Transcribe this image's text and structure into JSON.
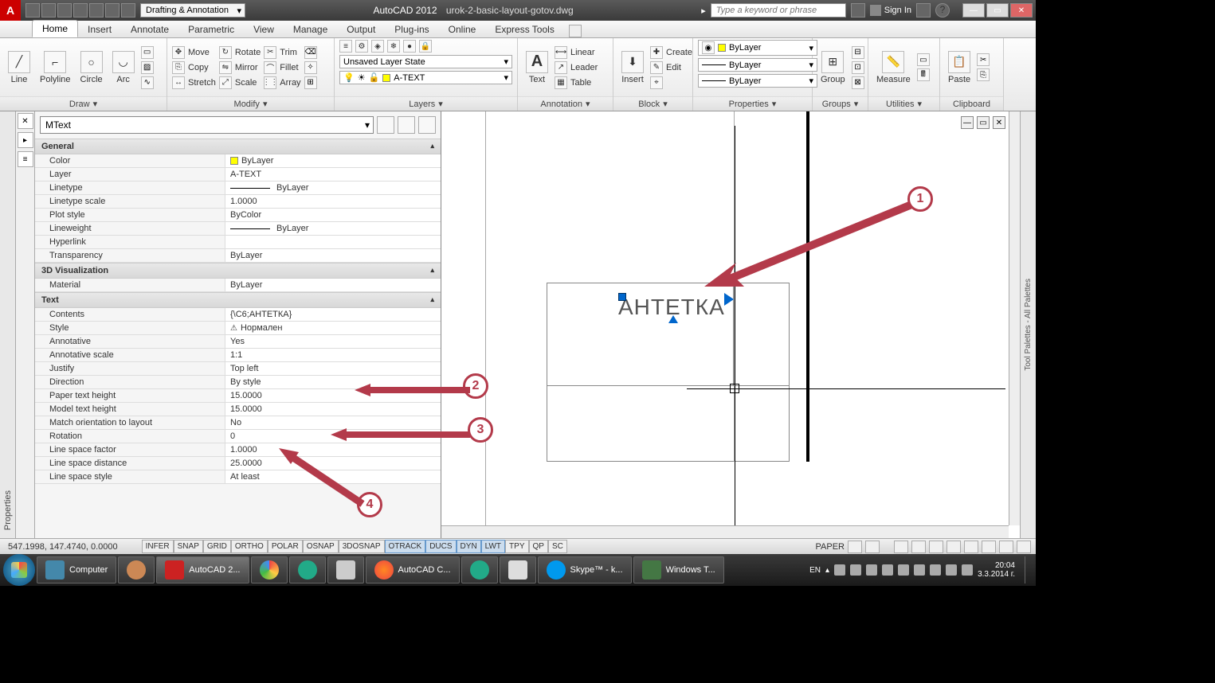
{
  "titlebar": {
    "workspace": "Drafting & Annotation",
    "app": "AutoCAD 2012",
    "file": "urok-2-basic-layout-gotov.dwg",
    "search_placeholder": "Type a keyword or phrase",
    "signin": "Sign In"
  },
  "ribbon_tabs": [
    "Home",
    "Insert",
    "Annotate",
    "Parametric",
    "View",
    "Manage",
    "Output",
    "Plug-ins",
    "Online",
    "Express Tools"
  ],
  "ribbon": {
    "draw": {
      "title": "Draw",
      "line": "Line",
      "polyline": "Polyline",
      "circle": "Circle",
      "arc": "Arc"
    },
    "modify": {
      "title": "Modify",
      "move": "Move",
      "rotate": "Rotate",
      "trim": "Trim",
      "copy": "Copy",
      "mirror": "Mirror",
      "fillet": "Fillet",
      "stretch": "Stretch",
      "scale": "Scale",
      "array": "Array"
    },
    "layers": {
      "title": "Layers",
      "state": "Unsaved Layer State",
      "current": "A-TEXT"
    },
    "annotation": {
      "title": "Annotation",
      "text": "Text",
      "linear": "Linear",
      "leader": "Leader",
      "table": "Table"
    },
    "block": {
      "title": "Block",
      "insert": "Insert",
      "create": "Create",
      "edit": "Edit"
    },
    "properties": {
      "title": "Properties",
      "bylayer": "ByLayer"
    },
    "groups": {
      "title": "Groups",
      "group": "Group"
    },
    "utilities": {
      "title": "Utilities",
      "measure": "Measure"
    },
    "clipboard": {
      "title": "Clipboard",
      "paste": "Paste"
    }
  },
  "properties_palette": {
    "object_type": "MText",
    "sections": {
      "general": {
        "title": "General",
        "rows": [
          {
            "k": "Color",
            "v": "ByLayer",
            "swatch": true
          },
          {
            "k": "Layer",
            "v": "A-TEXT"
          },
          {
            "k": "Linetype",
            "v": "ByLayer",
            "line": true
          },
          {
            "k": "Linetype scale",
            "v": "1.0000"
          },
          {
            "k": "Plot style",
            "v": "ByColor"
          },
          {
            "k": "Lineweight",
            "v": "ByLayer",
            "line": true
          },
          {
            "k": "Hyperlink",
            "v": ""
          },
          {
            "k": "Transparency",
            "v": "ByLayer"
          }
        ]
      },
      "viz3d": {
        "title": "3D Visualization",
        "rows": [
          {
            "k": "Material",
            "v": "ByLayer"
          }
        ]
      },
      "text": {
        "title": "Text",
        "rows": [
          {
            "k": "Contents",
            "v": "{\\C6;АНТЕТКА}"
          },
          {
            "k": "Style",
            "v": "Нормален",
            "anno_icon": true
          },
          {
            "k": "Annotative",
            "v": "Yes"
          },
          {
            "k": "Annotative scale",
            "v": "1:1"
          },
          {
            "k": "Justify",
            "v": "Top left"
          },
          {
            "k": "Direction",
            "v": "By style"
          },
          {
            "k": "Paper text height",
            "v": "15.0000"
          },
          {
            "k": "Model text height",
            "v": "15.0000"
          },
          {
            "k": "Match orientation to layout",
            "v": "No"
          },
          {
            "k": "Rotation",
            "v": "0"
          },
          {
            "k": "Line space factor",
            "v": "1.0000"
          },
          {
            "k": "Line space distance",
            "v": "25.0000"
          },
          {
            "k": "Line space style",
            "v": "At least"
          }
        ]
      }
    }
  },
  "canvas": {
    "mtext": "АНТЕТКА"
  },
  "annotations": {
    "a1": "1",
    "a2": "2",
    "a3": "3",
    "a4": "4"
  },
  "statusbar": {
    "coords": "547.1998, 147.4740, 0.0000",
    "toggles": [
      "INFER",
      "SNAP",
      "GRID",
      "ORTHO",
      "POLAR",
      "OSNAP",
      "3DOSNAP",
      "OTRACK",
      "DUCS",
      "DYN",
      "LWT",
      "TPY",
      "QP",
      "SC"
    ],
    "toggles_on": [
      "OTRACK",
      "DUCS",
      "DYN",
      "LWT"
    ],
    "space": "PAPER"
  },
  "taskbar": {
    "computer": "Computer",
    "acad": "AutoCAD 2...",
    "ff": "AutoCAD C...",
    "skype": "Skype™ - k...",
    "wt": "Windows T...",
    "lang": "EN",
    "time": "20:04",
    "date": "3.3.2014 г."
  },
  "sidebar_labels": {
    "properties": "Properties",
    "palettes": "Tool Palettes - All Palettes"
  }
}
